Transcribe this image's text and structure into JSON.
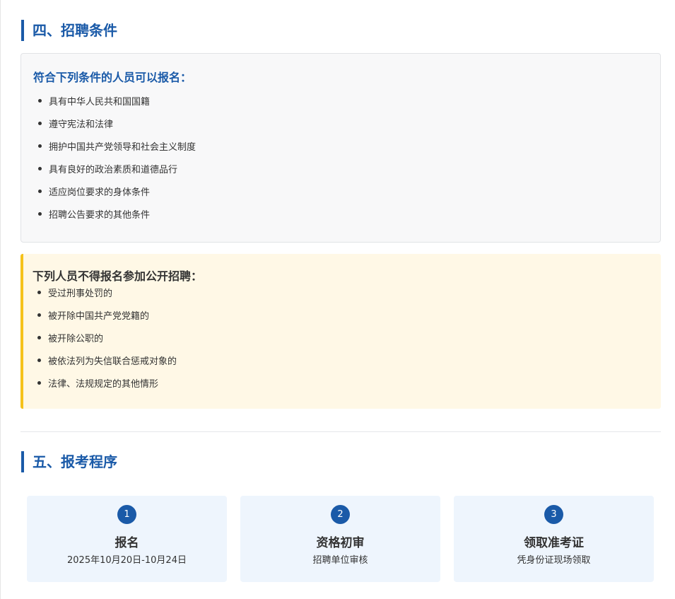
{
  "section4": {
    "title": "四、招聘条件",
    "eligible": {
      "heading": "符合下列条件的人员可以报名：",
      "items": [
        "具有中华人民共和国国籍",
        "遵守宪法和法律",
        "拥护中国共产党领导和社会主义制度",
        "具有良好的政治素质和道德品行",
        "适应岗位要求的身体条件",
        "招聘公告要求的其他条件"
      ]
    },
    "excluded": {
      "heading": "下列人员不得报名参加公开招聘：",
      "items": [
        "受过刑事处罚的",
        "被开除中国共产党党籍的",
        "被开除公职的",
        "被依法列为失信联合惩戒对象的",
        "法律、法规规定的其他情形"
      ]
    }
  },
  "section5": {
    "title": "五、报考程序",
    "steps": [
      {
        "number": "1",
        "title": "报名",
        "desc": "2025年10月20日-10月24日"
      },
      {
        "number": "2",
        "title": "资格初审",
        "desc": "招聘单位审核"
      },
      {
        "number": "3",
        "title": "领取准考证",
        "desc": "凭身份证现场领取"
      }
    ]
  },
  "colors": {
    "accent": "#1a5aa8",
    "warning_border": "#f5c21b",
    "warning_bg": "#fff8e6",
    "step_bg": "#eef5fd"
  }
}
